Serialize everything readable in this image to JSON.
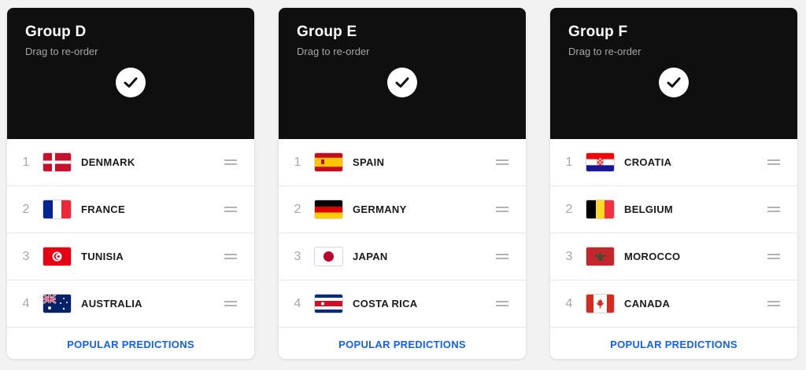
{
  "colors": {
    "header_bg": "#0f0f0f",
    "link": "#1463e6",
    "rank": "#a8a8a8"
  },
  "groups": [
    {
      "title": "Group D",
      "subtitle": "Drag to re-order",
      "check_icon": "check-icon",
      "teams": [
        {
          "rank": "1",
          "name": "DENMARK"
        },
        {
          "rank": "2",
          "name": "FRANCE"
        },
        {
          "rank": "3",
          "name": "TUNISIA"
        },
        {
          "rank": "4",
          "name": "AUSTRALIA"
        }
      ],
      "link": "POPULAR PREDICTIONS"
    },
    {
      "title": "Group E",
      "subtitle": "Drag to re-order",
      "check_icon": "check-icon",
      "teams": [
        {
          "rank": "1",
          "name": "SPAIN"
        },
        {
          "rank": "2",
          "name": "GERMANY"
        },
        {
          "rank": "3",
          "name": "JAPAN"
        },
        {
          "rank": "4",
          "name": "COSTA RICA"
        }
      ],
      "link": "POPULAR PREDICTIONS"
    },
    {
      "title": "Group F",
      "subtitle": "Drag to re-order",
      "check_icon": "check-icon",
      "teams": [
        {
          "rank": "1",
          "name": "CROATIA"
        },
        {
          "rank": "2",
          "name": "BELGIUM"
        },
        {
          "rank": "3",
          "name": "MOROCCO"
        },
        {
          "rank": "4",
          "name": "CANADA"
        }
      ],
      "link": "POPULAR PREDICTIONS"
    }
  ]
}
